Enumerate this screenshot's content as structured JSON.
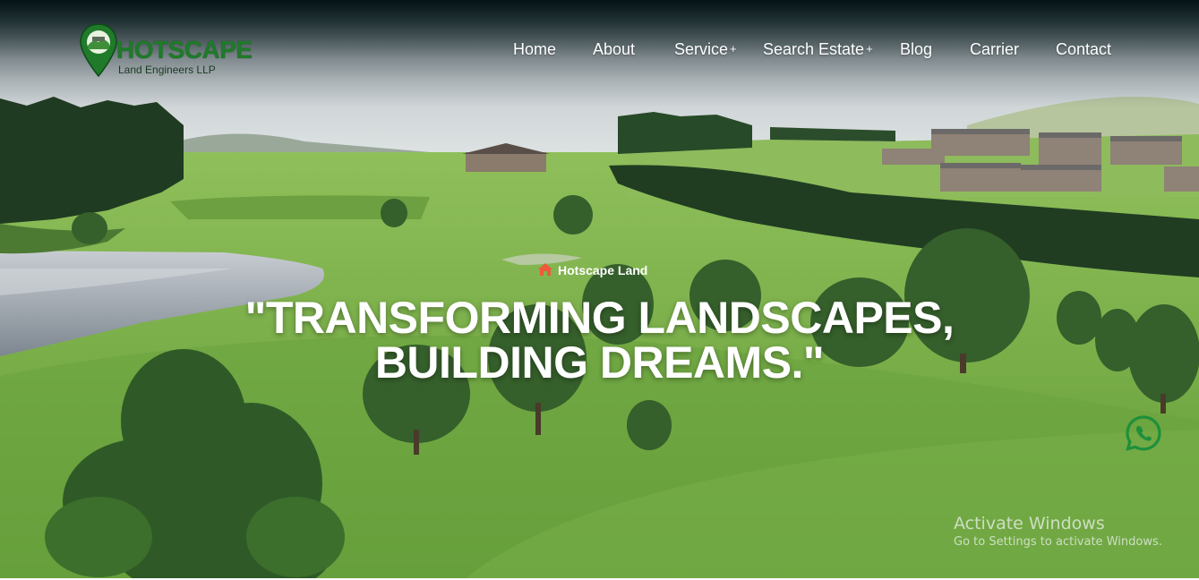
{
  "brand": {
    "name": "HOTSCAPE",
    "tagline": "Land Engineers LLP",
    "icon": "map-pin-logo-icon",
    "color": "#1f7a2a"
  },
  "nav": {
    "items": [
      {
        "label": "Home",
        "has_submenu": false
      },
      {
        "label": "About",
        "has_submenu": false
      },
      {
        "label": "Service",
        "has_submenu": true,
        "indicator": "+"
      },
      {
        "label": "Search Estate",
        "has_submenu": true,
        "indicator": "+"
      },
      {
        "label": "Blog",
        "has_submenu": false
      },
      {
        "label": "Carrier",
        "has_submenu": false
      },
      {
        "label": "Contact",
        "has_submenu": false
      }
    ]
  },
  "hero": {
    "eyebrow_icon": "home-icon",
    "eyebrow_icon_color": "#ef5a3c",
    "eyebrow": "Hotscape Land",
    "headline_line1": "\"TRANSFORMING LANDSCAPES,",
    "headline_line2": "BUILDING DREAMS.\""
  },
  "floating": {
    "whatsapp_icon": "whatsapp-icon",
    "whatsapp_color": "#1e8f3a"
  },
  "os_watermark": {
    "title": "Activate Windows",
    "subtitle": "Go to Settings to activate Windows."
  }
}
